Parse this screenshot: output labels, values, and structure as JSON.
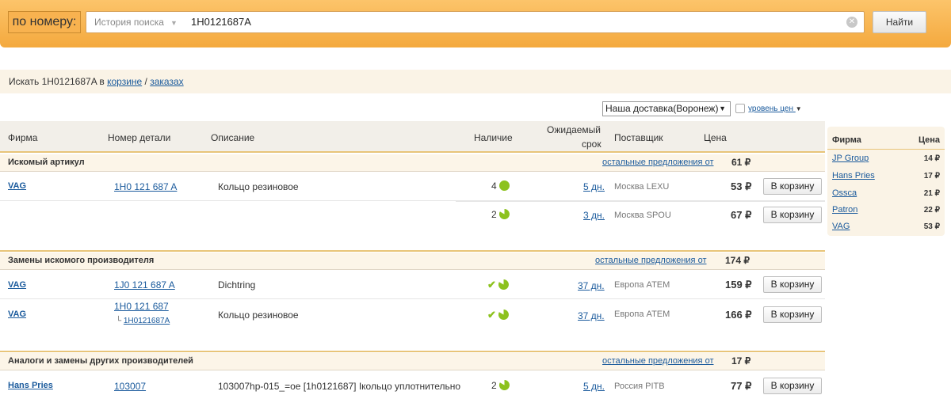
{
  "search": {
    "label": "по номеру:",
    "history": "История поиска",
    "query": "1H0121687A",
    "clear": "⊗",
    "button": "Найти"
  },
  "info": {
    "prefix": "Искать 1H0121687A в",
    "cart_link": "корзине",
    "sep": "/",
    "orders_link": "заказах"
  },
  "filters": {
    "delivery": "Наша доставка(Воронеж)",
    "price_level": "уровень цен"
  },
  "table": {
    "headers": {
      "firm": "Фирма",
      "part": "Номер детали",
      "desc": "Описание",
      "avail": "Наличие",
      "eta_line1": "Ожидаемый",
      "eta_line2": "срок",
      "supplier": "Поставщик",
      "price": "Цена"
    }
  },
  "sections": [
    {
      "title": "Искомый артикул",
      "other": "остальные предложения от",
      "other_price": "61 ₽"
    },
    {
      "title": "Замены искомого производителя",
      "other": "остальные предложения от",
      "other_price": "174 ₽"
    },
    {
      "title": "Аналоги и замены других производителей",
      "other": "остальные предложения от",
      "other_price": "17 ₽"
    }
  ],
  "rows": [
    {
      "firm": "VAG",
      "part": "1H0 121 687 A",
      "desc": "Кольцо резиновое",
      "qty": "4",
      "days": "5 дн.",
      "supplier": "Москва LEXU",
      "price": "53 ₽",
      "cart": "В корзину"
    },
    {
      "qty": "2",
      "days": "3 дн.",
      "supplier": "Москва SPOU",
      "price": "67 ₽",
      "cart": "В корзину"
    },
    {
      "firm": "VAG",
      "part": "1J0 121 687 A",
      "desc": "Dichtring",
      "days": "37 дн.",
      "supplier": "Европа ATEM",
      "price": "159 ₽",
      "cart": "В корзину"
    },
    {
      "firm": "VAG",
      "part": "1H0 121 687",
      "sub": "1H0121687A",
      "desc": "Кольцо резиновое",
      "days": "37 дн.",
      "supplier": "Европа ATEM",
      "price": "166 ₽",
      "cart": "В корзину"
    },
    {
      "firm": "Hans Pries",
      "part": "103007",
      "desc": "103007hp-015_=oe [1h0121687] Ікольцо уплотнительно",
      "qty": "2",
      "days": "5 дн.",
      "supplier": "Россия PITB",
      "price": "77 ₽",
      "cart": "В корзину"
    }
  ],
  "sidebar": {
    "head_firm": "Фирма",
    "head_price": "Цена",
    "items": [
      {
        "firm": "JP Group",
        "price": "14 ₽"
      },
      {
        "firm": "Hans Pries",
        "price": "17 ₽"
      },
      {
        "firm": "Ossca",
        "price": "21 ₽"
      },
      {
        "firm": "Patron",
        "price": "22 ₽"
      },
      {
        "firm": "VAG",
        "price": "53 ₽"
      }
    ]
  },
  "colors": {
    "accent": "#f4a93e",
    "link": "#1a5a9c",
    "stock": "#8dc21f"
  },
  "icons": {
    "avail_full": "full-circle-icon",
    "avail_partial": "pie-icon",
    "avail_check": "check-icon"
  }
}
